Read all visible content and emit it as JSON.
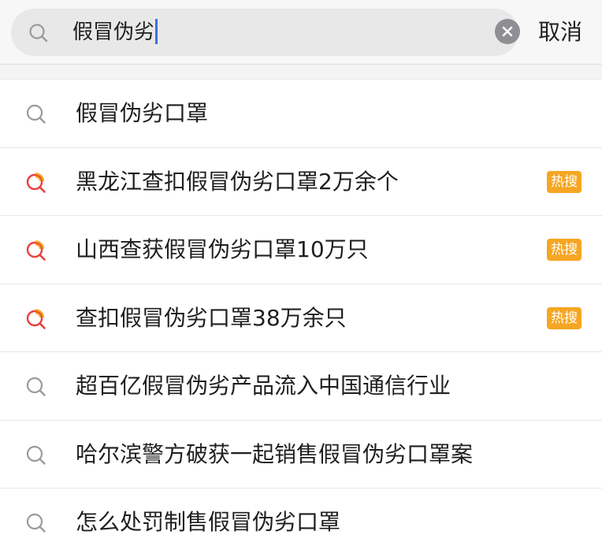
{
  "search": {
    "query": "假冒伪劣",
    "cancel_label": "取消",
    "icon": "search-icon",
    "clear_icon": "clear-icon"
  },
  "colors": {
    "caret": "#3b6fe0",
    "hot_badge": "#f5a623",
    "hot_icon_red": "#e8413d",
    "hot_icon_orange": "#f5a623",
    "normal_icon": "#9a9a9a"
  },
  "suggestions": [
    {
      "text": "假冒伪劣口罩",
      "hot": false,
      "icon": "search-icon"
    },
    {
      "text": "黑龙江查扣假冒伪劣口罩2万余个",
      "hot": true,
      "badge": "热搜",
      "icon": "hot-search-icon"
    },
    {
      "text": "山西查获假冒伪劣口罩10万只",
      "hot": true,
      "badge": "热搜",
      "icon": "hot-search-icon"
    },
    {
      "text": "查扣假冒伪劣口罩38万余只",
      "hot": true,
      "badge": "热搜",
      "icon": "hot-search-icon"
    },
    {
      "text": "超百亿假冒伪劣产品流入中国通信行业",
      "hot": false,
      "icon": "search-icon"
    },
    {
      "text": "哈尔滨警方破获一起销售假冒伪劣口罩案",
      "hot": false,
      "icon": "search-icon"
    },
    {
      "text": "怎么处罚制售假冒伪劣口罩",
      "hot": false,
      "icon": "search-icon"
    }
  ]
}
